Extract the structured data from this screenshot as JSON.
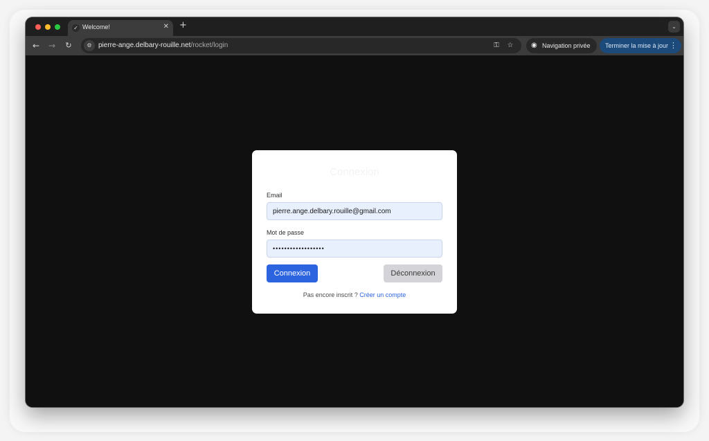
{
  "browser": {
    "tab_title": "Welcome!",
    "tab_favicon": "rocket-favicon",
    "url_domain": "pierre-ange.delbary-rouille.net",
    "url_path": "/rocket/login",
    "incognito_label": "Navigation privée",
    "update_label": "Terminer la mise à jour",
    "theme_colors": {
      "tabstrip": "#1f1f1f",
      "toolbar": "#3c3c3c",
      "update_button": "#1c4a7a"
    }
  },
  "login": {
    "title": "Connexion",
    "email_label": "Email",
    "email_value": "pierre.ange.delbary.rouille@gmail.com",
    "password_label": "Mot de passe",
    "password_value": "••••••••••••••••••",
    "login_button": "Connexion",
    "logout_button": "Déconnexion",
    "signup_prompt": "Pas encore inscrit ?",
    "signup_link": "Créer un compte",
    "colors": {
      "primary": "#2c64e0",
      "secondary_button": "#d4d4d8",
      "input_bg": "#e8f0fe"
    }
  }
}
